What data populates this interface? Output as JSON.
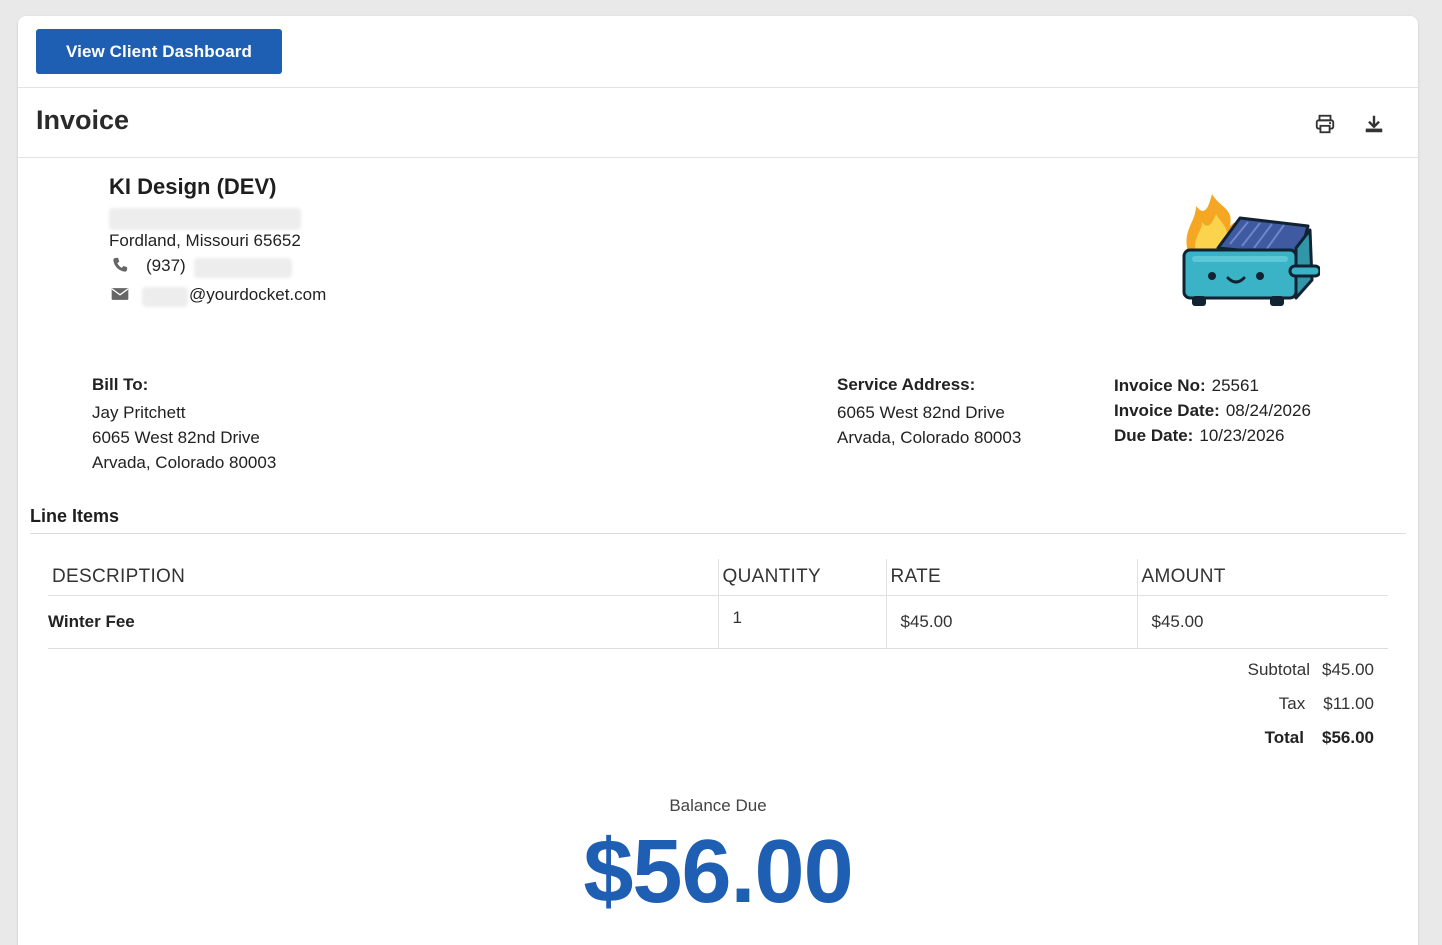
{
  "toolbar": {
    "dashboard_button_label": "View Client Dashboard"
  },
  "header": {
    "title": "Invoice",
    "print_icon": "print-icon",
    "download_icon": "download-icon"
  },
  "company": {
    "name": "KI Design (DEV)",
    "city_line": "Fordland, Missouri 65652",
    "phone_prefix": "(937)",
    "email_suffix": "@yourdocket.com"
  },
  "bill_to": {
    "label": "Bill To:",
    "name": "Jay Pritchett",
    "street": "6065 West 82nd Drive",
    "city_line": "Arvada, Colorado 80003"
  },
  "service_address": {
    "label": "Service Address:",
    "street": "6065 West 82nd Drive",
    "city_line": "Arvada, Colorado 80003"
  },
  "invoice_meta": {
    "number_label": "Invoice No:",
    "number": "25561",
    "date_label": "Invoice Date:",
    "date": "08/24/2026",
    "due_label": "Due Date:",
    "due": "10/23/2026"
  },
  "line_items": {
    "section_title": "Line Items",
    "columns": [
      "DESCRIPTION",
      "QUANTITY",
      "RATE",
      "AMOUNT"
    ],
    "rows": [
      {
        "description": "Winter Fee",
        "quantity": "1",
        "rate": "$45.00",
        "amount": "$45.00"
      }
    ]
  },
  "totals": {
    "subtotal_label": "Subtotal",
    "subtotal": "$45.00",
    "tax_label": "Tax",
    "tax": "$11.00",
    "total_label": "Total",
    "total": "$56.00"
  },
  "balance": {
    "label": "Balance Due",
    "value": "$56.00"
  },
  "colors": {
    "primary": "#1f5fb3",
    "background": "#e9e9ea"
  }
}
